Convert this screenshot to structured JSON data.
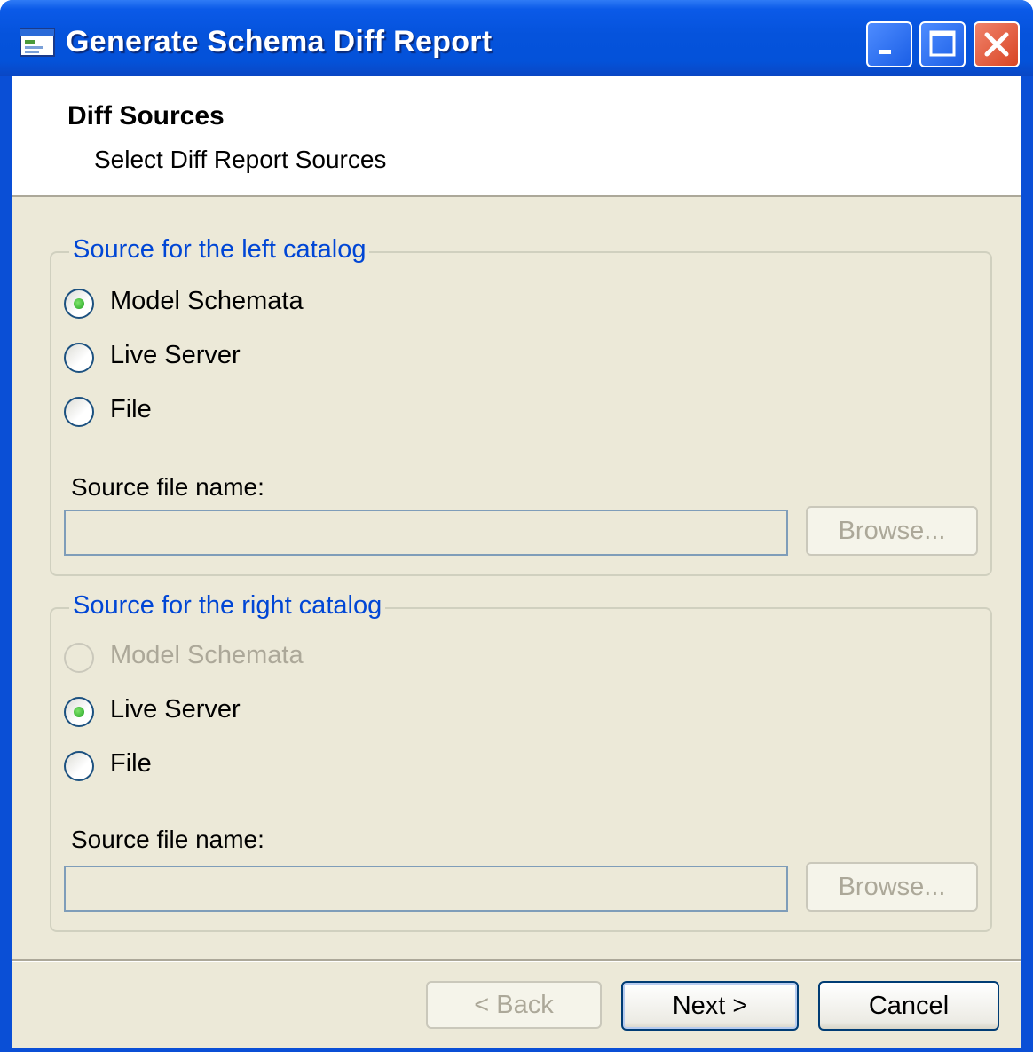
{
  "window": {
    "title": "Generate Schema Diff Report",
    "icon": "app-window-icon",
    "controls": [
      "minimize-icon",
      "maximize-icon",
      "close-icon"
    ]
  },
  "header": {
    "title": "Diff Sources",
    "subtitle": "Select Diff Report Sources"
  },
  "left_group": {
    "legend": "Source for the left catalog",
    "options": [
      {
        "label": "Model Schemata",
        "selected": true,
        "enabled": true
      },
      {
        "label": "Live Server",
        "selected": false,
        "enabled": true
      },
      {
        "label": "File",
        "selected": false,
        "enabled": true
      }
    ],
    "file_label": "Source file name:",
    "file_value": "",
    "browse_label": "Browse..."
  },
  "right_group": {
    "legend": "Source for the right catalog",
    "options": [
      {
        "label": "Model Schemata",
        "selected": false,
        "enabled": false
      },
      {
        "label": "Live Server",
        "selected": true,
        "enabled": true
      },
      {
        "label": "File",
        "selected": false,
        "enabled": true
      }
    ],
    "file_label": "Source file name:",
    "file_value": "",
    "browse_label": "Browse..."
  },
  "footer": {
    "back_label": "< Back",
    "next_label": "Next >",
    "cancel_label": "Cancel"
  },
  "colors": {
    "titlebar": "#0553dc",
    "client_bg": "#ece9d8",
    "legend_text": "#0046d5",
    "disabled_text": "#aca899"
  }
}
